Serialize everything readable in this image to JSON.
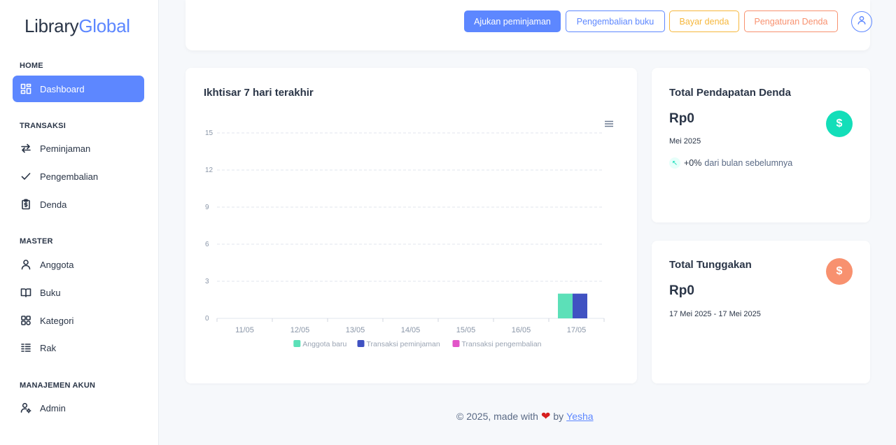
{
  "sidebar": {
    "logo_part1": "Library",
    "logo_part2": "Global",
    "sections": {
      "home": "HOME",
      "transaksi": "TRANSAKSI",
      "master": "MASTER",
      "akun": "MANAJEMEN AKUN"
    },
    "items": {
      "dashboard": "Dashboard",
      "peminjaman": "Peminjaman",
      "pengembalian": "Pengembalian",
      "denda": "Denda",
      "anggota": "Anggota",
      "buku": "Buku",
      "kategori": "Kategori",
      "rak": "Rak",
      "admin": "Admin"
    }
  },
  "header": {
    "btn_ajukan": "Ajukan peminjaman",
    "btn_pengembalian": "Pengembalian buku",
    "btn_bayar": "Bayar denda",
    "btn_pengaturan": "Pengaturan Denda"
  },
  "chart_card": {
    "title": "Ikhtisar 7 hari terakhir"
  },
  "chart_data": {
    "type": "bar",
    "title": "Ikhtisar 7 hari terakhir",
    "categories": [
      "11/05",
      "12/05",
      "13/05",
      "14/05",
      "15/05",
      "16/05",
      "17/05"
    ],
    "series": [
      {
        "name": "Anggota baru",
        "color": "#5ce0b8",
        "values": [
          0,
          0,
          0,
          0,
          0,
          0,
          2
        ]
      },
      {
        "name": "Transaksi peminjaman",
        "color": "#4052c2",
        "values": [
          0,
          0,
          0,
          0,
          0,
          0,
          2
        ]
      },
      {
        "name": "Transaksi pengembalian",
        "color": "#e255c8",
        "values": [
          0,
          0,
          0,
          0,
          0,
          0,
          0
        ]
      }
    ],
    "yticks": [
      0,
      3,
      6,
      9,
      12,
      15
    ],
    "ylim": [
      0,
      15
    ],
    "grid": true,
    "legend": "bottom-center"
  },
  "denda_card": {
    "title": "Total Pendapatan Denda",
    "amount": "Rp0",
    "period": "Mei 2025",
    "change_pct": "+0%",
    "change_text": "dari bulan sebelumnya",
    "icon": "$"
  },
  "tunggakan_card": {
    "title": "Total Tunggakan",
    "amount": "Rp0",
    "period": "17 Mei 2025 - 17 Mei 2025",
    "icon": "$"
  },
  "footer": {
    "text": "© 2025, made with",
    "by": "by",
    "author": "Yesha"
  }
}
